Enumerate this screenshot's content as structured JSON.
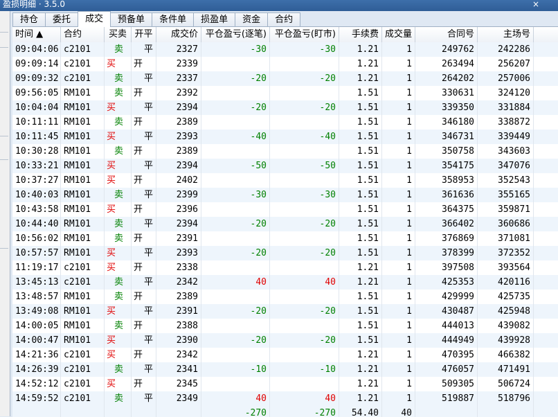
{
  "window": {
    "title": "盈损明细 · 3.5.0"
  },
  "tabs": [
    "持仓",
    "委托",
    "成交",
    "预备单",
    "条件单",
    "损盈单",
    "资金",
    "合约"
  ],
  "active_tab": 2,
  "columns": [
    "时间 ▲",
    "合约",
    "买卖",
    "开平",
    "成交价",
    "平仓盈亏(逐笔)",
    "平仓盈亏(盯市)",
    "手续费",
    "成交量",
    "合同号",
    "主场号"
  ],
  "rows": [
    {
      "time": "09:04:06",
      "contract": "c2101",
      "side": "卖",
      "oc": "平",
      "price": "2327",
      "pnl_trade": "-30",
      "pnl_mark": "-30",
      "fee": "1.21",
      "qty": "1",
      "order_no": "249762",
      "exch_no": "242286"
    },
    {
      "time": "09:09:14",
      "contract": "c2101",
      "side": "买",
      "oc": "开",
      "price": "2339",
      "pnl_trade": "",
      "pnl_mark": "",
      "fee": "1.21",
      "qty": "1",
      "order_no": "263494",
      "exch_no": "256207"
    },
    {
      "time": "09:09:32",
      "contract": "c2101",
      "side": "卖",
      "oc": "平",
      "price": "2337",
      "pnl_trade": "-20",
      "pnl_mark": "-20",
      "fee": "1.21",
      "qty": "1",
      "order_no": "264202",
      "exch_no": "257006"
    },
    {
      "time": "09:56:05",
      "contract": "RM101",
      "side": "卖",
      "oc": "开",
      "price": "2392",
      "pnl_trade": "",
      "pnl_mark": "",
      "fee": "1.51",
      "qty": "1",
      "order_no": "330631",
      "exch_no": "324120"
    },
    {
      "time": "10:04:04",
      "contract": "RM101",
      "side": "买",
      "oc": "平",
      "price": "2394",
      "pnl_trade": "-20",
      "pnl_mark": "-20",
      "fee": "1.51",
      "qty": "1",
      "order_no": "339350",
      "exch_no": "331884"
    },
    {
      "time": "10:11:11",
      "contract": "RM101",
      "side": "卖",
      "oc": "开",
      "price": "2389",
      "pnl_trade": "",
      "pnl_mark": "",
      "fee": "1.51",
      "qty": "1",
      "order_no": "346180",
      "exch_no": "338872"
    },
    {
      "time": "10:11:45",
      "contract": "RM101",
      "side": "买",
      "oc": "平",
      "price": "2393",
      "pnl_trade": "-40",
      "pnl_mark": "-40",
      "fee": "1.51",
      "qty": "1",
      "order_no": "346731",
      "exch_no": "339449"
    },
    {
      "time": "10:30:28",
      "contract": "RM101",
      "side": "卖",
      "oc": "开",
      "price": "2389",
      "pnl_trade": "",
      "pnl_mark": "",
      "fee": "1.51",
      "qty": "1",
      "order_no": "350758",
      "exch_no": "343603"
    },
    {
      "time": "10:33:21",
      "contract": "RM101",
      "side": "买",
      "oc": "平",
      "price": "2394",
      "pnl_trade": "-50",
      "pnl_mark": "-50",
      "fee": "1.51",
      "qty": "1",
      "order_no": "354175",
      "exch_no": "347076"
    },
    {
      "time": "10:37:27",
      "contract": "RM101",
      "side": "买",
      "oc": "开",
      "price": "2402",
      "pnl_trade": "",
      "pnl_mark": "",
      "fee": "1.51",
      "qty": "1",
      "order_no": "358953",
      "exch_no": "352543"
    },
    {
      "time": "10:40:03",
      "contract": "RM101",
      "side": "卖",
      "oc": "平",
      "price": "2399",
      "pnl_trade": "-30",
      "pnl_mark": "-30",
      "fee": "1.51",
      "qty": "1",
      "order_no": "361636",
      "exch_no": "355165"
    },
    {
      "time": "10:43:58",
      "contract": "RM101",
      "side": "买",
      "oc": "开",
      "price": "2396",
      "pnl_trade": "",
      "pnl_mark": "",
      "fee": "1.51",
      "qty": "1",
      "order_no": "364375",
      "exch_no": "359871"
    },
    {
      "time": "10:44:40",
      "contract": "RM101",
      "side": "卖",
      "oc": "平",
      "price": "2394",
      "pnl_trade": "-20",
      "pnl_mark": "-20",
      "fee": "1.51",
      "qty": "1",
      "order_no": "366402",
      "exch_no": "360686"
    },
    {
      "time": "10:56:02",
      "contract": "RM101",
      "side": "卖",
      "oc": "开",
      "price": "2391",
      "pnl_trade": "",
      "pnl_mark": "",
      "fee": "1.51",
      "qty": "1",
      "order_no": "376869",
      "exch_no": "371081"
    },
    {
      "time": "10:57:57",
      "contract": "RM101",
      "side": "买",
      "oc": "平",
      "price": "2393",
      "pnl_trade": "-20",
      "pnl_mark": "-20",
      "fee": "1.51",
      "qty": "1",
      "order_no": "378399",
      "exch_no": "372352"
    },
    {
      "time": "11:19:17",
      "contract": "c2101",
      "side": "买",
      "oc": "开",
      "price": "2338",
      "pnl_trade": "",
      "pnl_mark": "",
      "fee": "1.21",
      "qty": "1",
      "order_no": "397508",
      "exch_no": "393564"
    },
    {
      "time": "13:45:13",
      "contract": "c2101",
      "side": "卖",
      "oc": "平",
      "price": "2342",
      "pnl_trade": "40",
      "pnl_mark": "40",
      "fee": "1.21",
      "qty": "1",
      "order_no": "425353",
      "exch_no": "420116"
    },
    {
      "time": "13:48:57",
      "contract": "RM101",
      "side": "卖",
      "oc": "开",
      "price": "2389",
      "pnl_trade": "",
      "pnl_mark": "",
      "fee": "1.51",
      "qty": "1",
      "order_no": "429999",
      "exch_no": "425735"
    },
    {
      "time": "13:49:08",
      "contract": "RM101",
      "side": "买",
      "oc": "平",
      "price": "2391",
      "pnl_trade": "-20",
      "pnl_mark": "-20",
      "fee": "1.51",
      "qty": "1",
      "order_no": "430487",
      "exch_no": "425948"
    },
    {
      "time": "14:00:05",
      "contract": "RM101",
      "side": "卖",
      "oc": "开",
      "price": "2388",
      "pnl_trade": "",
      "pnl_mark": "",
      "fee": "1.51",
      "qty": "1",
      "order_no": "444013",
      "exch_no": "439082"
    },
    {
      "time": "14:00:47",
      "contract": "RM101",
      "side": "买",
      "oc": "平",
      "price": "2390",
      "pnl_trade": "-20",
      "pnl_mark": "-20",
      "fee": "1.51",
      "qty": "1",
      "order_no": "444949",
      "exch_no": "439928"
    },
    {
      "time": "14:21:36",
      "contract": "c2101",
      "side": "买",
      "oc": "开",
      "price": "2342",
      "pnl_trade": "",
      "pnl_mark": "",
      "fee": "1.21",
      "qty": "1",
      "order_no": "470395",
      "exch_no": "466382"
    },
    {
      "time": "14:26:39",
      "contract": "c2101",
      "side": "卖",
      "oc": "平",
      "price": "2341",
      "pnl_trade": "-10",
      "pnl_mark": "-10",
      "fee": "1.21",
      "qty": "1",
      "order_no": "476057",
      "exch_no": "471491"
    },
    {
      "time": "14:52:12",
      "contract": "c2101",
      "side": "买",
      "oc": "开",
      "price": "2345",
      "pnl_trade": "",
      "pnl_mark": "",
      "fee": "1.21",
      "qty": "1",
      "order_no": "509305",
      "exch_no": "506724"
    },
    {
      "time": "14:59:52",
      "contract": "c2101",
      "side": "卖",
      "oc": "平",
      "price": "2349",
      "pnl_trade": "40",
      "pnl_mark": "40",
      "fee": "1.21",
      "qty": "1",
      "order_no": "519887",
      "exch_no": "518796"
    }
  ],
  "totals": {
    "pnl_trade": "-270",
    "pnl_mark": "-270",
    "fee": "54.40",
    "qty": "40"
  },
  "colors": {
    "buy": "#e00000",
    "sell": "#008000",
    "header_bar": "#2f5d96"
  }
}
